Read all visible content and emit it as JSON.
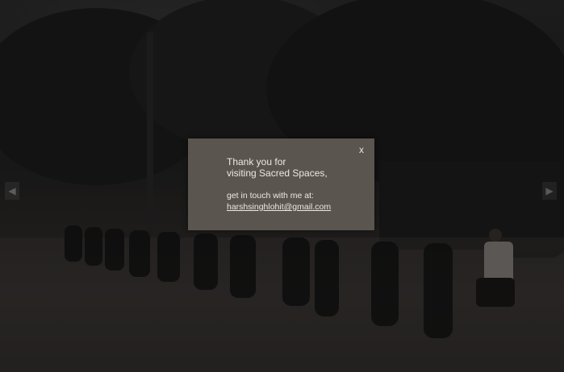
{
  "modal": {
    "close_label": "x",
    "heading_line1": "Thank you for",
    "heading_line2": "visiting Sacred Spaces,",
    "contact_text": "get in touch with me at:",
    "email": "harshsinghlohit@gmail.com"
  },
  "navigation": {
    "prev_icon": "chevron-left-icon",
    "next_icon": "chevron-right-icon"
  },
  "colors": {
    "modal_background": "#5b5550",
    "modal_text": "#ece8e3",
    "page_background": "#1a1a1a"
  }
}
